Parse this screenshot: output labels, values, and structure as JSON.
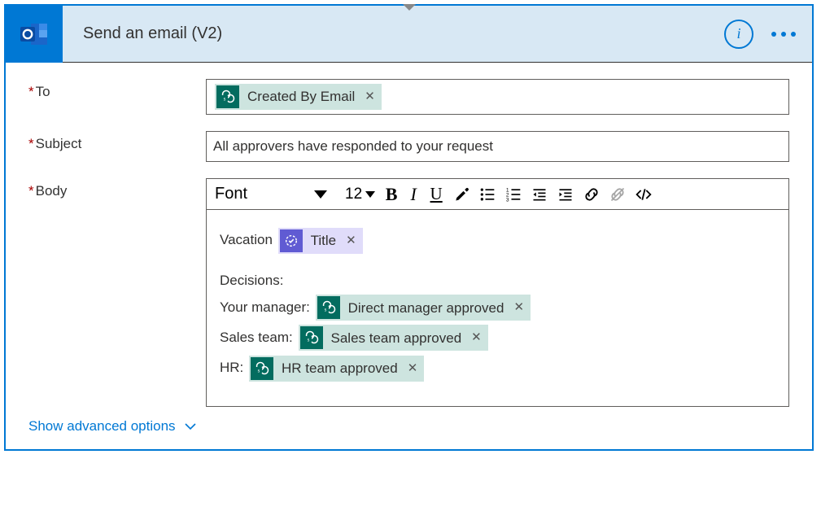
{
  "header": {
    "title": "Send an email (V2)",
    "info_label": "i"
  },
  "fields": {
    "to": {
      "label": "To",
      "token": {
        "type": "sharepoint",
        "text": "Created By Email"
      }
    },
    "subject": {
      "label": "Subject",
      "value": "All approvers have responded to your request"
    },
    "body": {
      "label": "Body",
      "toolbar": {
        "font": "Font",
        "size": "12"
      },
      "lines": {
        "vacation_prefix": "Vacation",
        "vacation_token": {
          "type": "approval",
          "text": "Title"
        },
        "decisions_heading": "Decisions:",
        "mgr_prefix": "Your manager:",
        "mgr_token": {
          "type": "sharepoint",
          "text": "Direct manager approved"
        },
        "sales_prefix": "Sales team:",
        "sales_token": {
          "type": "sharepoint",
          "text": "Sales team approved"
        },
        "hr_prefix": "HR:",
        "hr_token": {
          "type": "sharepoint",
          "text": "HR team approved"
        }
      }
    }
  },
  "advanced": {
    "label": "Show advanced options"
  }
}
